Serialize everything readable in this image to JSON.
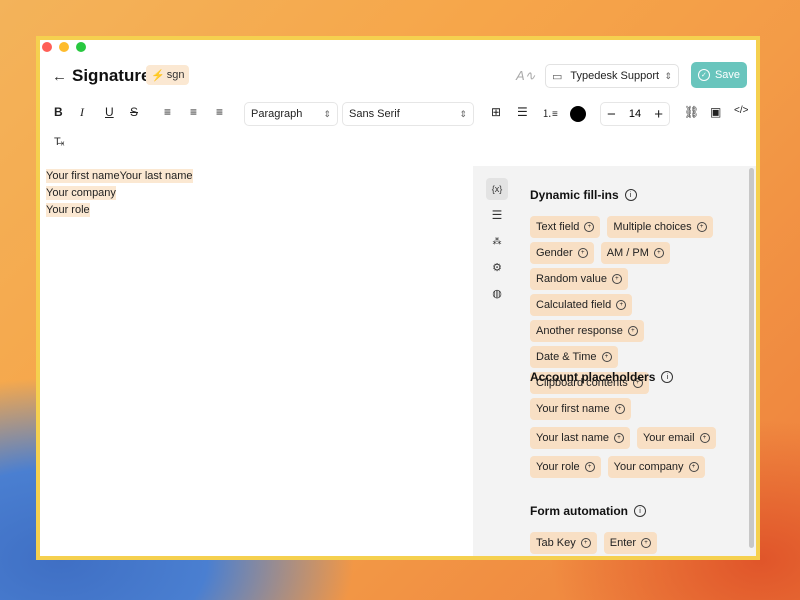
{
  "header": {
    "title": "Signature",
    "shortcut": "sgn",
    "folder": "Typedesk Support",
    "save_label": "Save"
  },
  "toolbar": {
    "block_format": "Paragraph",
    "font_family": "Sans Serif",
    "font_size": "14"
  },
  "editor": {
    "first_name": "Your first name",
    "last_name": "Your last name",
    "company": "Your company",
    "role": "Your role"
  },
  "panel": {
    "dynamic": {
      "title": "Dynamic fill-ins",
      "items": [
        "Text field",
        "Multiple choices",
        "Gender",
        "AM / PM",
        "Random value",
        "Calculated field",
        "Another response",
        "Date & Time",
        "Clipboard contents"
      ]
    },
    "account": {
      "title": "Account placeholders",
      "items": [
        "Your first name",
        "Your last name",
        "Your email",
        "Your role",
        "Your company"
      ]
    },
    "automation": {
      "title": "Form automation",
      "items": [
        "Tab Key",
        "Enter"
      ]
    },
    "side_icons": [
      "variable-icon",
      "list-icon",
      "nodes-icon",
      "gear-icon",
      "globe-icon"
    ]
  }
}
